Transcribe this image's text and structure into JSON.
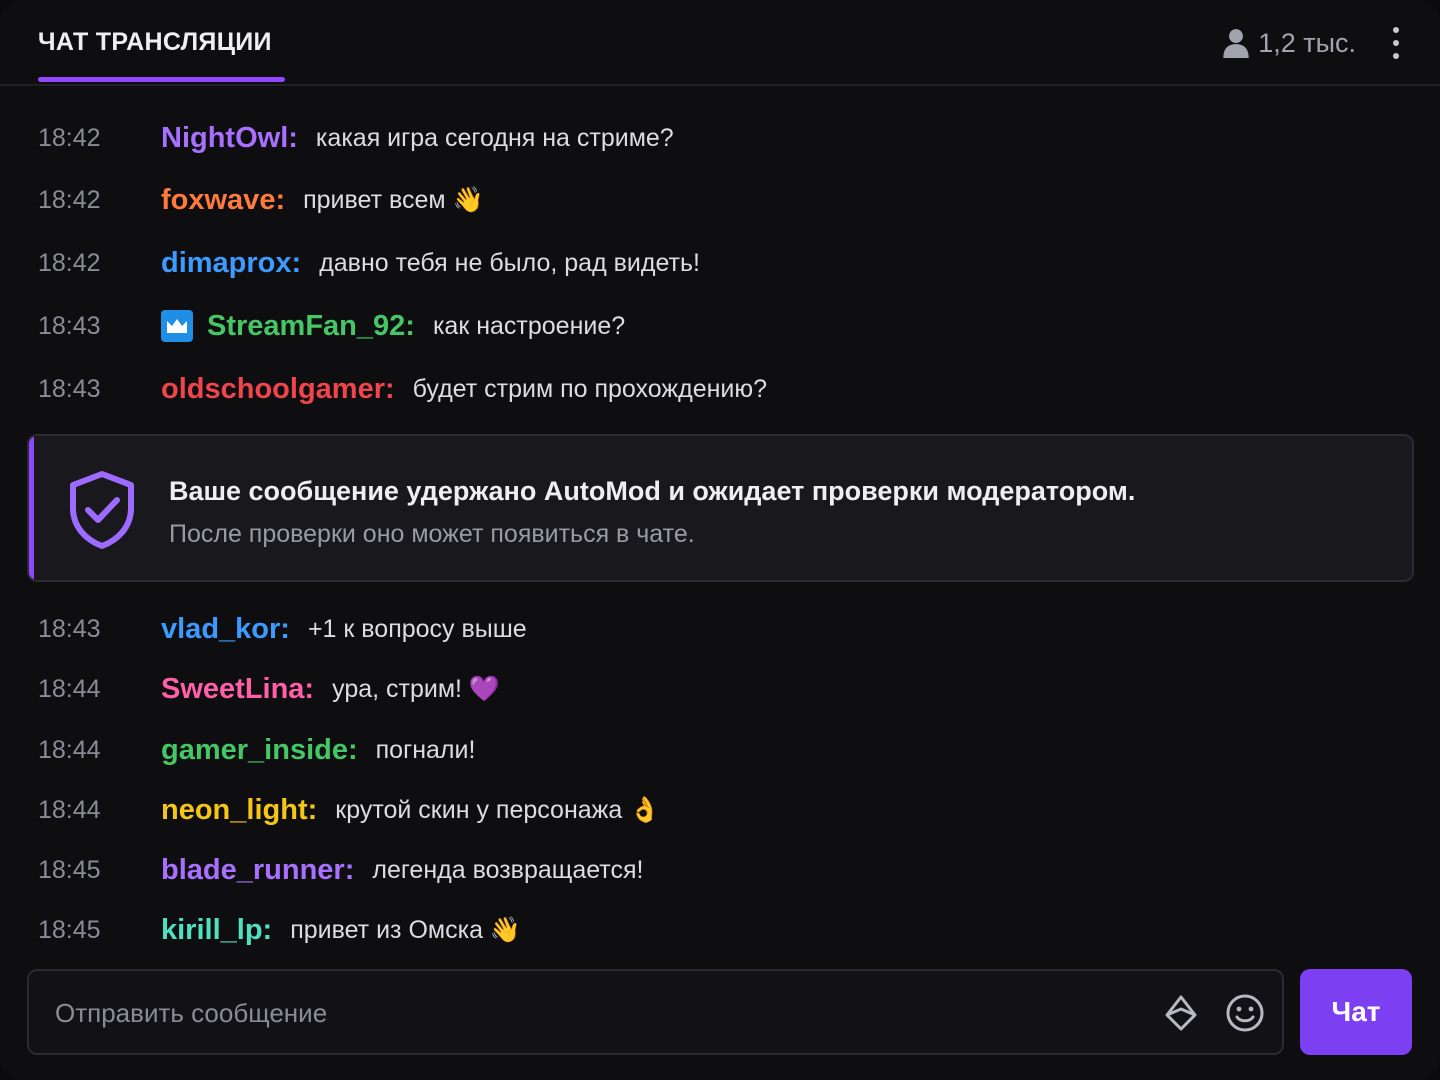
{
  "header": {
    "title": "ЧАТ ТРАНСЛЯЦИИ",
    "viewer_count": "1,2 тыс.",
    "viewer_icon": "user-icon",
    "more_icon": "more-vertical-icon"
  },
  "colors": {
    "accent": "#9147ff",
    "send_button": "#7c3ff2"
  },
  "messages_top": [
    {
      "time": "18:42",
      "user": "NightOwl:",
      "color": "#a970ff",
      "text": "какая игра сегодня на стриме?"
    },
    {
      "time": "18:42",
      "user": "foxwave:",
      "color": "#ff7a3d",
      "text": "привет всем 👋"
    },
    {
      "time": "18:42",
      "user": "dimaprox:",
      "color": "#3d9bff",
      "text": "давно тебя не было, рад видеть!"
    },
    {
      "time": "18:43",
      "user": "StreamFan_92:",
      "color": "#45c765",
      "text": "как настроение?",
      "badge": "crown-icon"
    },
    {
      "time": "18:43",
      "user": "oldschoolgamer:",
      "color": "#f0454a",
      "text": "будет стрим по прохождению?"
    }
  ],
  "automod": {
    "icon": "shield-check-icon",
    "title": "Ваше сообщение удержано AutoMod и ожидает проверки модератором.",
    "subtitle": "После проверки оно может появиться в чате."
  },
  "messages_bottom": [
    {
      "time": "18:43",
      "user": "vlad_kor:",
      "color": "#3d9bff",
      "text": "+1 к вопросу выше"
    },
    {
      "time": "18:44",
      "user": "SweetLina:",
      "color": "#ff5fa8",
      "text": "ура, стрим! 💜"
    },
    {
      "time": "18:44",
      "user": "gamer_inside:",
      "color": "#45c765",
      "text": "погнали!"
    },
    {
      "time": "18:44",
      "user": "neon_light:",
      "color": "#f5c518",
      "text": "крутой скин у персонажа 👌"
    },
    {
      "time": "18:45",
      "user": "blade_runner:",
      "color": "#a970ff",
      "text": "легенда возвращается!"
    },
    {
      "time": "18:45",
      "user": "kirill_lp:",
      "color": "#4fe0c0",
      "text": "привет из Омска 👋"
    }
  ],
  "composer": {
    "placeholder": "Отправить сообщение",
    "bits_icon": "bits-diamond-icon",
    "emote_icon": "smiley-icon",
    "send_label": "Чат"
  }
}
